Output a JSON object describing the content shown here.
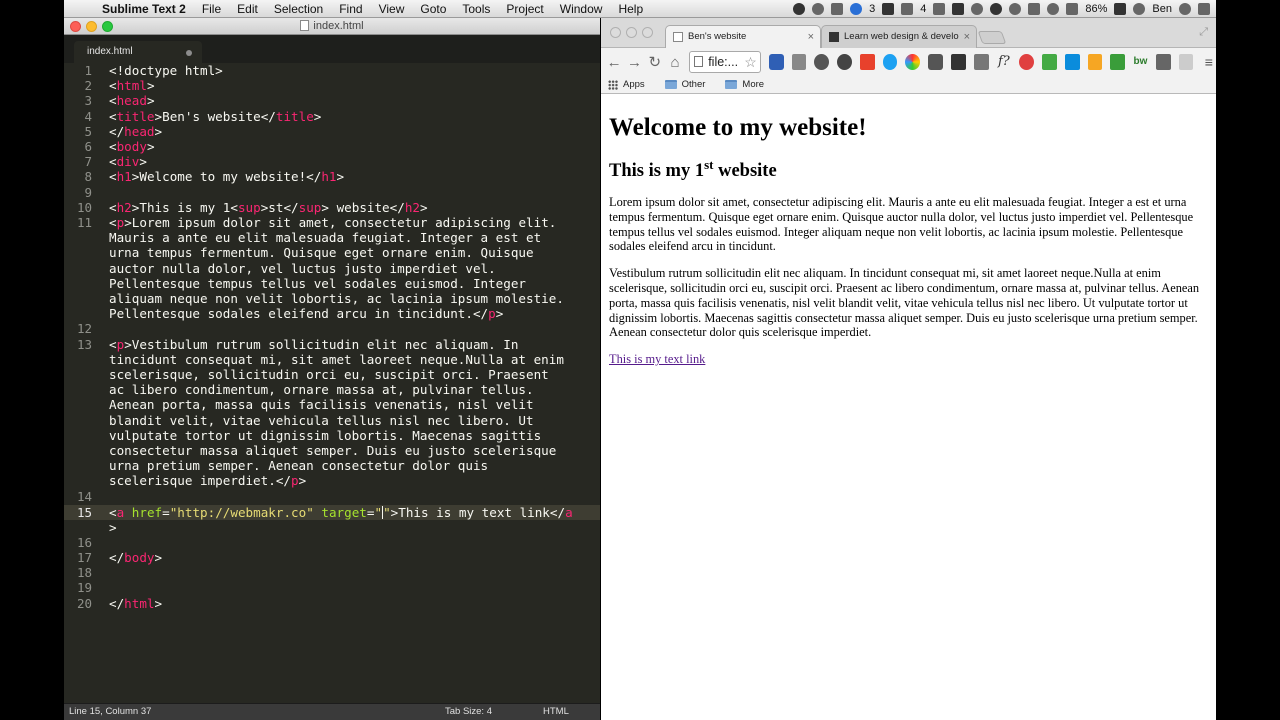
{
  "menubar": {
    "app_name": "Sublime Text 2",
    "items": [
      "File",
      "Edit",
      "Selection",
      "Find",
      "View",
      "Goto",
      "Tools",
      "Project",
      "Window",
      "Help"
    ],
    "tray": {
      "badge_3": "3",
      "badge_4": "4",
      "battery": "86%",
      "user": "Ben"
    }
  },
  "sublime": {
    "window_title": "index.html",
    "tab_label": "index.html",
    "status": {
      "position": "Line 15, Column 37",
      "tab_size": "Tab Size: 4",
      "syntax": "HTML"
    },
    "line_numbers": [
      "1",
      "2",
      "3",
      "4",
      "5",
      "6",
      "7",
      "8",
      "9",
      "10",
      "11",
      "12",
      "13",
      "14",
      "15",
      "16",
      "17",
      "18",
      "19",
      "20"
    ],
    "current_line": "15",
    "code": {
      "l1": "<!doctype html>",
      "l2_tag": "html",
      "l3_tag": "head",
      "l4_tag": "title",
      "l4_text": "Ben's website",
      "l5_tag": "head",
      "l6_tag": "body",
      "l7_tag": "div",
      "l8_tag": "h1",
      "l8_text": "Welcome to my website!",
      "l10_tag": "h2",
      "l10_pre": "This is my 1",
      "l10_sup": "sup",
      "l10_mid": "st",
      "l10_post": " website",
      "l11_tag": "p",
      "l11_lines": [
        "Lorem ipsum dolor sit amet, consectetur adipiscing elit.",
        "Mauris a ante eu elit malesuada feugiat. Integer a est et",
        "urna tempus fermentum. Quisque eget ornare enim. Quisque",
        "auctor nulla dolor, vel luctus justo imperdiet vel.",
        "Pellentesque tempus tellus vel sodales euismod. Integer",
        "aliquam neque non velit lobortis, ac lacinia ipsum molestie.",
        "Pellentesque sodales eleifend arcu in tincidunt."
      ],
      "l13_tag": "p",
      "l13_lines": [
        "Vestibulum rutrum sollicitudin elit nec aliquam. In",
        "tincidunt consequat mi, sit amet laoreet neque.Nulla at enim",
        "scelerisque, sollicitudin orci eu, suscipit orci. Praesent",
        "ac libero condimentum, ornare massa at, pulvinar tellus.",
        "Aenean porta, massa quis facilisis venenatis, nisl velit",
        "blandit velit, vitae vehicula tellus nisl nec libero. Ut",
        "vulputate tortor ut dignissim lobortis. Maecenas sagittis",
        "consectetur massa aliquet semper. Duis eu justo scelerisque",
        "urna pretium semper. Aenean consectetur dolor quis",
        "scelerisque imperdiet."
      ],
      "l15_tag": "a",
      "l15_href_attr": "href",
      "l15_href_val": "\"http://webmakr.co\"",
      "l15_target_attr": "target",
      "l15_target_open": "\"",
      "l15_target_close": "\"",
      "l15_text": "This is my text link",
      "l15_close_tag": "a",
      "l17_tag": "body",
      "l20_tag": "html"
    }
  },
  "chrome": {
    "tabs": [
      {
        "label": "Ben's website",
        "close": "×"
      },
      {
        "label": "Learn web design & develo",
        "close": "×"
      }
    ],
    "omnibox_value": "file:...",
    "bookmarks": [
      "Apps",
      "Other",
      "More"
    ],
    "extension_labels": {
      "f": "f?",
      "bw": "bw",
      "menu": "≡"
    },
    "page": {
      "h1": "Welcome to my website!",
      "h2_pre": "This is my 1",
      "h2_sup": "st",
      "h2_post": " website",
      "p1": "Lorem ipsum dolor sit amet, consectetur adipiscing elit. Mauris a ante eu elit malesuada feugiat. Integer a est et urna tempus fermentum. Quisque eget ornare enim. Quisque auctor nulla dolor, vel luctus justo imperdiet vel. Pellentesque tempus tellus vel sodales euismod. Integer aliquam neque non velit lobortis, ac lacinia ipsum molestie. Pellentesque sodales eleifend arcu in tincidunt.",
      "p2": "Vestibulum rutrum sollicitudin elit nec aliquam. In tincidunt consequat mi, sit amet laoreet neque.Nulla at enim scelerisque, sollicitudin orci eu, suscipit orci. Praesent ac libero condimentum, ornare massa at, pulvinar tellus. Aenean porta, massa quis facilisis venenatis, nisl velit blandit velit, vitae vehicula tellus nisl nec libero. Ut vulputate tortor ut dignissim lobortis. Maecenas sagittis consectetur massa aliquet semper. Duis eu justo scelerisque urna pretium semper. Aenean consectetur dolor quis scelerisque imperdiet.",
      "link_text": "This is my text link"
    }
  },
  "colors": {
    "editor_bg": "#272822",
    "tag": "#f92672",
    "attr": "#a6e22e",
    "string": "#e6db74",
    "link_visited": "#551a8b"
  }
}
